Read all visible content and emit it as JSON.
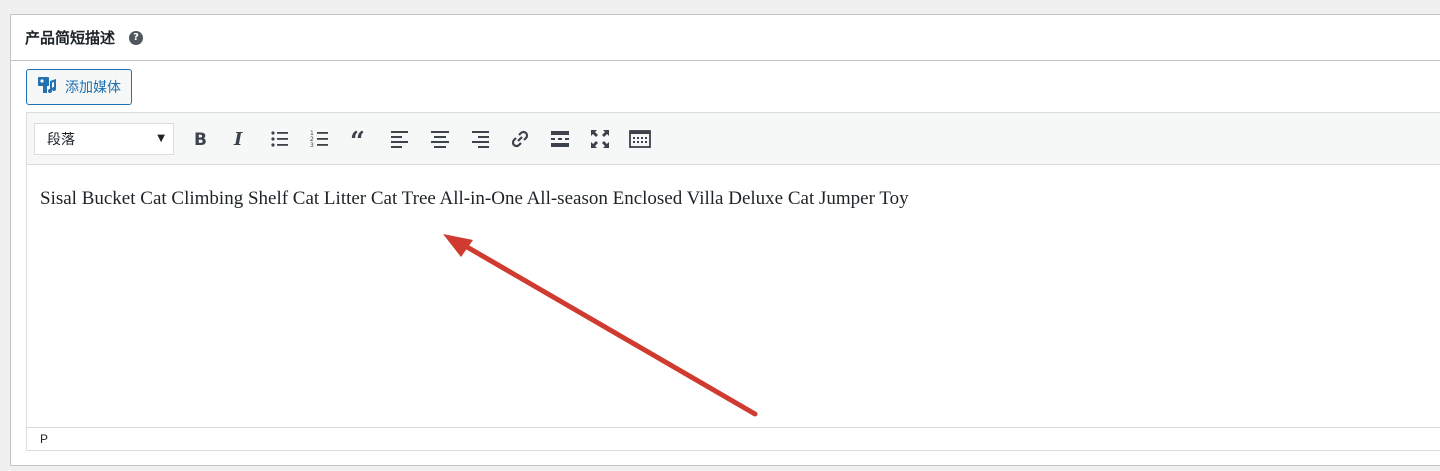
{
  "panel": {
    "title": "产品简短描述",
    "help_glyph": "?"
  },
  "media": {
    "add_media_label": "添加媒体"
  },
  "toolbar": {
    "format_value": "段落",
    "buttons": [
      "bold-icon",
      "italic-icon",
      "bulleted-list-icon",
      "numbered-list-icon",
      "blockquote-icon",
      "align-left-icon",
      "align-center-icon",
      "align-right-icon",
      "link-icon",
      "read-more-icon",
      "fullscreen-icon",
      "toolbar-toggle-icon"
    ]
  },
  "editor": {
    "content": "Sisal Bucket Cat Climbing Shelf Cat Litter Cat Tree All-in-One All-season Enclosed Villa Deluxe Cat Jumper Toy",
    "status_path": "P"
  },
  "annotation": {
    "arrow_color": "#cf3b2f"
  }
}
